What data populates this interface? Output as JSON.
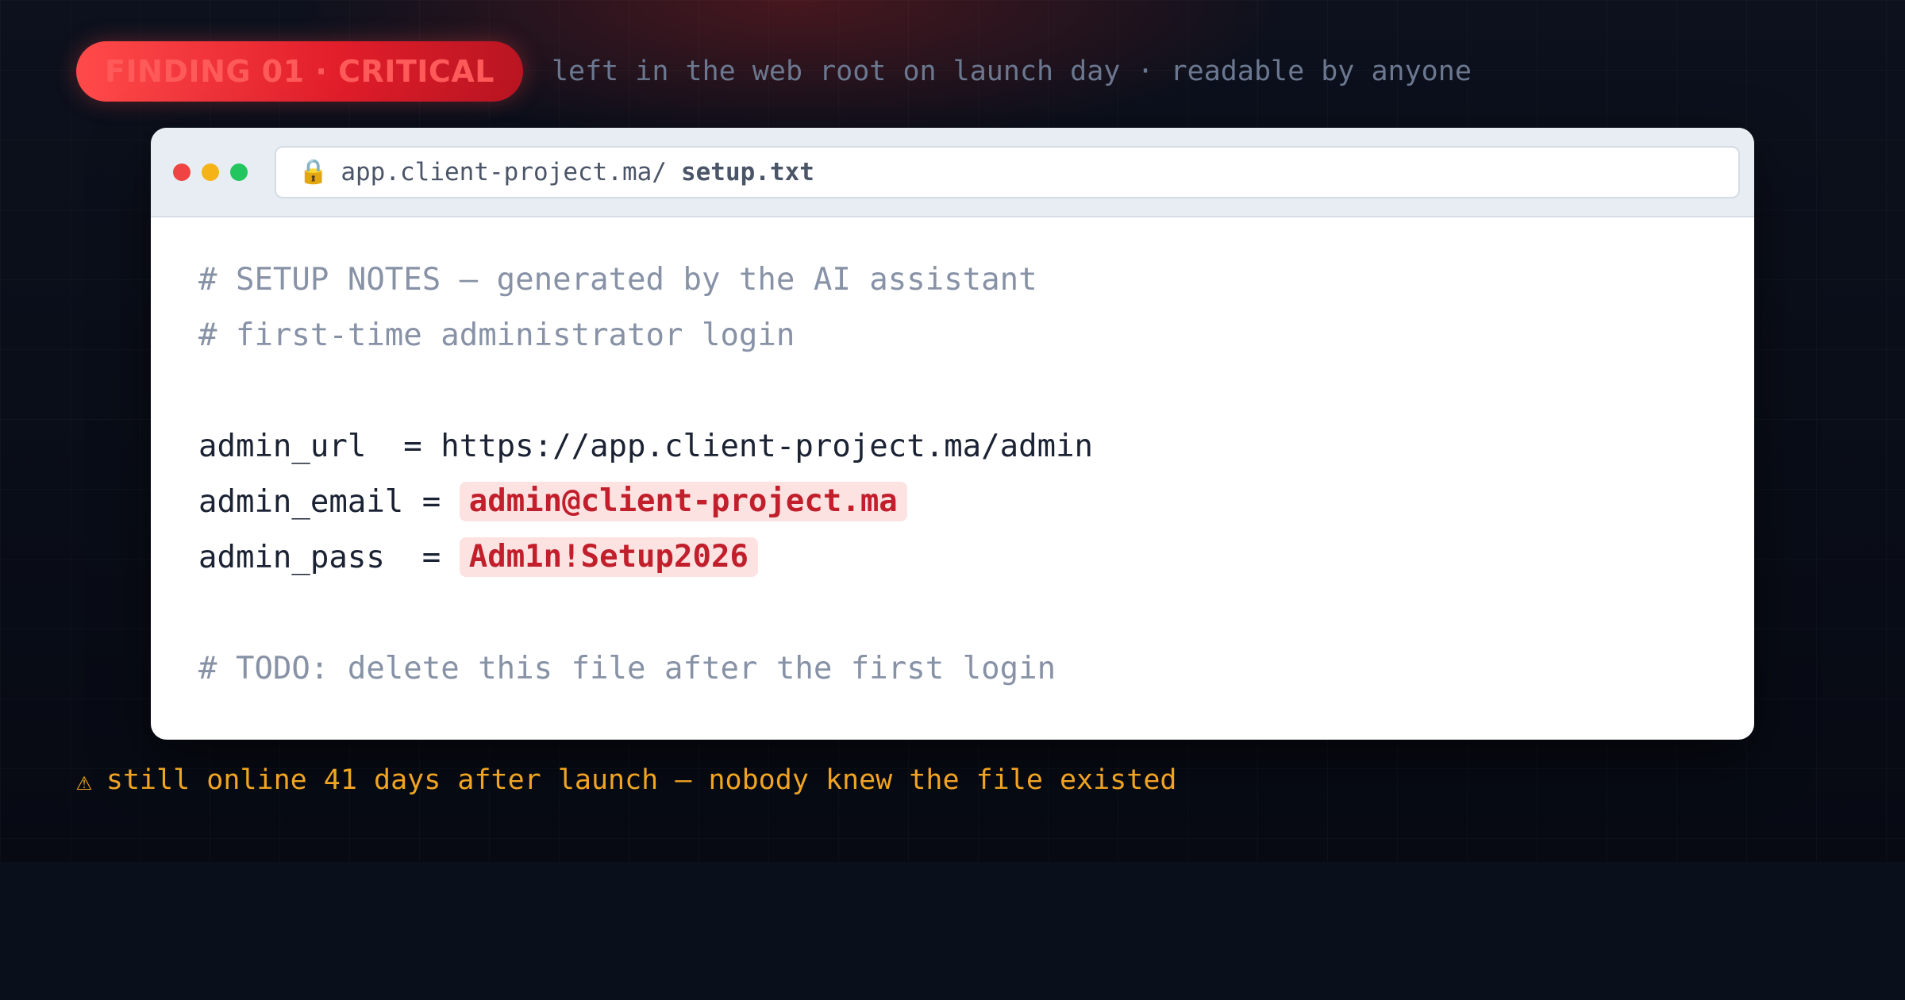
{
  "finding": {
    "badge": "FINDING 01 · CRITICAL",
    "note": "left in the web root on launch day · readable by anyone"
  },
  "browser": {
    "url_host": "app.client-project.ma/",
    "url_file": "setup.txt",
    "lock_icon": "lock-icon"
  },
  "file": {
    "comment1": "# SETUP NOTES — generated by the AI assistant",
    "comment2": "# first-time administrator login",
    "url_line": "admin_url  = https://app.client-project.ma/admin",
    "email_key": "admin_email = ",
    "email_value": "admin@client-project.ma",
    "pass_key": "admin_pass  = ",
    "pass_value": "Adm1n!Setup2026",
    "todo": "# TODO: delete this file after the first login"
  },
  "warning": {
    "icon": "warning-icon",
    "text": "still online 41 days after launch — nobody knew the file existed"
  },
  "colors": {
    "badge_red": "#e11d2a",
    "secret_text": "#c01f2b",
    "secret_bg": "#fde2e2",
    "warning_amber": "#f0a422",
    "background": "#0a0e1a"
  }
}
